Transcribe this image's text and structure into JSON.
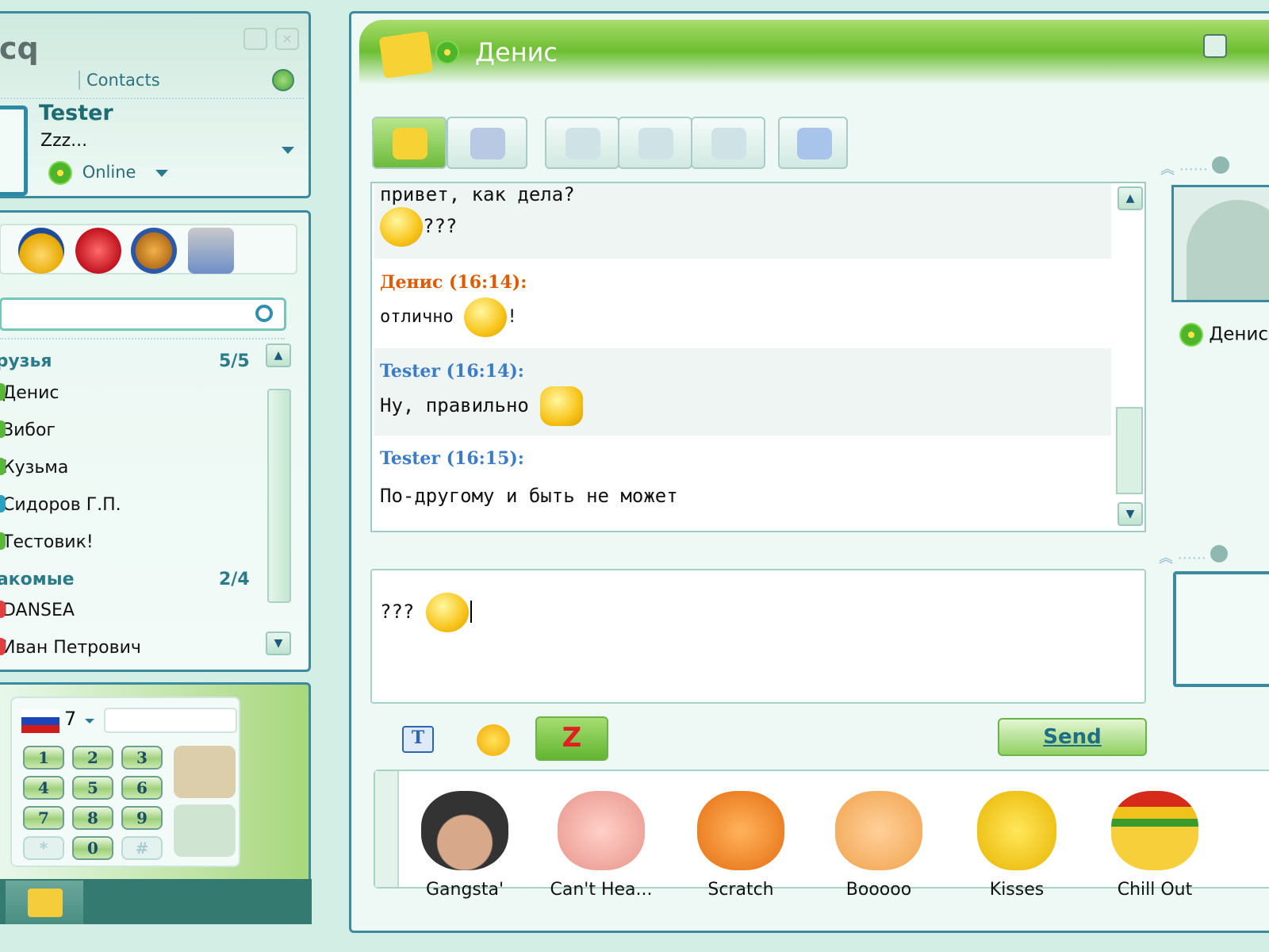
{
  "contact_list": {
    "logo": "cq",
    "contacts_tab": "Contacts",
    "user": {
      "name": "Tester",
      "status_message": "Zzz...",
      "status": "Online"
    },
    "search_placeholder": "",
    "groups": [
      {
        "name": "Друзья",
        "count": "5/5",
        "contacts": [
          "Денис",
          "Зибог",
          "Кузьма",
          "Сидоров Г.П.",
          "Тестовик!"
        ]
      },
      {
        "name": "Знакомые",
        "count": "2/4",
        "contacts": [
          "DANSEA",
          "Иван Петрович"
        ]
      }
    ],
    "dialpad": {
      "country_code": "7",
      "keys": [
        "1",
        "2",
        "3",
        "4",
        "5",
        "6",
        "7",
        "8",
        "9",
        "*",
        "0",
        "#"
      ]
    }
  },
  "chat_window": {
    "title": "Денис",
    "messages": [
      {
        "text": "привет, как дела?"
      },
      {
        "text": "???"
      },
      {
        "author": "Денис (16:14):",
        "text": "отлично",
        "suffix": "!"
      },
      {
        "author": "Tester (16:14):",
        "text": "Ну, правильно"
      },
      {
        "author": "Tester (16:15):",
        "text": "По-другому и быть не может"
      }
    ],
    "input_text": "???",
    "send_label": "Send",
    "contact_name": "Денис",
    "stickers": [
      "Gangsta'",
      "Can't Hea...",
      "Scratch",
      "Booooo",
      "Kisses",
      "Chill Out"
    ],
    "colors": {
      "incoming_nick": "#e05a00",
      "outgoing_nick": "#3a7cc8",
      "accent": "#6dbb3c"
    }
  }
}
